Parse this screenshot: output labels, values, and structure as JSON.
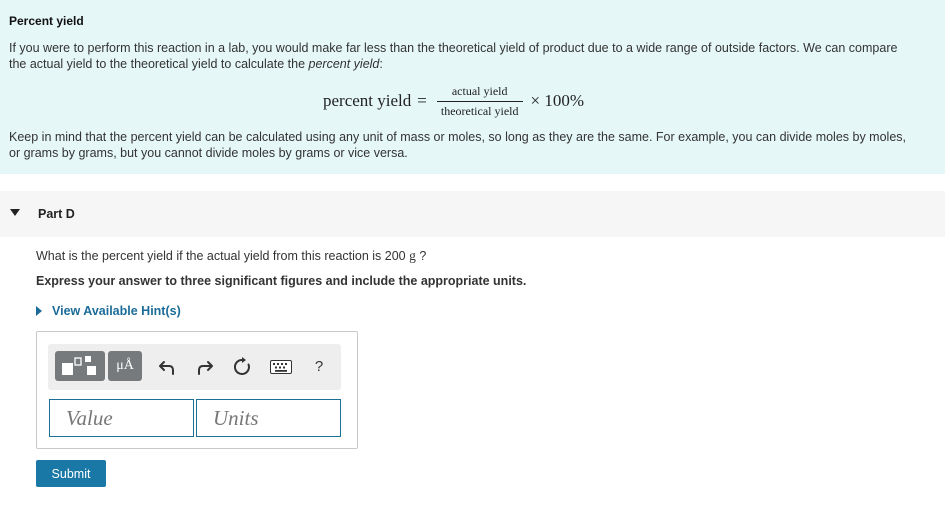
{
  "intro": {
    "title": "Percent yield",
    "para1_main": "If you were to perform this reaction in a lab, you would make far less than the theoretical yield of product due to a wide range of outside factors. We can compare the actual yield to the theoretical yield to calculate the ",
    "para1_emphasis": "percent yield",
    "para1_end": ":",
    "formula": {
      "lhs": "percent yield",
      "eq": "=",
      "numerator": "actual yield",
      "denominator": "theoretical yield",
      "rhs": "× 100%"
    },
    "para2": "Keep in mind that the percent yield can be calculated using any unit of mass or moles, so long as they are the same. For example, you can divide moles by moles, or grams by grams, but you cannot divide moles by grams or vice versa."
  },
  "part": {
    "label": "Part D",
    "question_text": "What is the percent yield if the actual yield from this reaction is 200 ",
    "question_unit": "g",
    "question_end": " ?",
    "instruction": "Express your answer to three significant figures and include the appropriate units.",
    "hint_label": "View Available Hint(s)"
  },
  "toolbar": {
    "units_label": "μÅ",
    "help_label": "?",
    "icons": [
      "templates-icon",
      "units-icon",
      "undo-icon",
      "redo-icon",
      "reset-icon",
      "keyboard-icon",
      "help-icon"
    ]
  },
  "inputs": {
    "value_placeholder": "Value",
    "units_placeholder": "Units"
  },
  "submit_label": "Submit",
  "colors": {
    "intro_bg": "#e6f7f8",
    "accent": "#1a78a6",
    "link": "#1c6c99",
    "toolbar_btn": "#777a7c"
  }
}
